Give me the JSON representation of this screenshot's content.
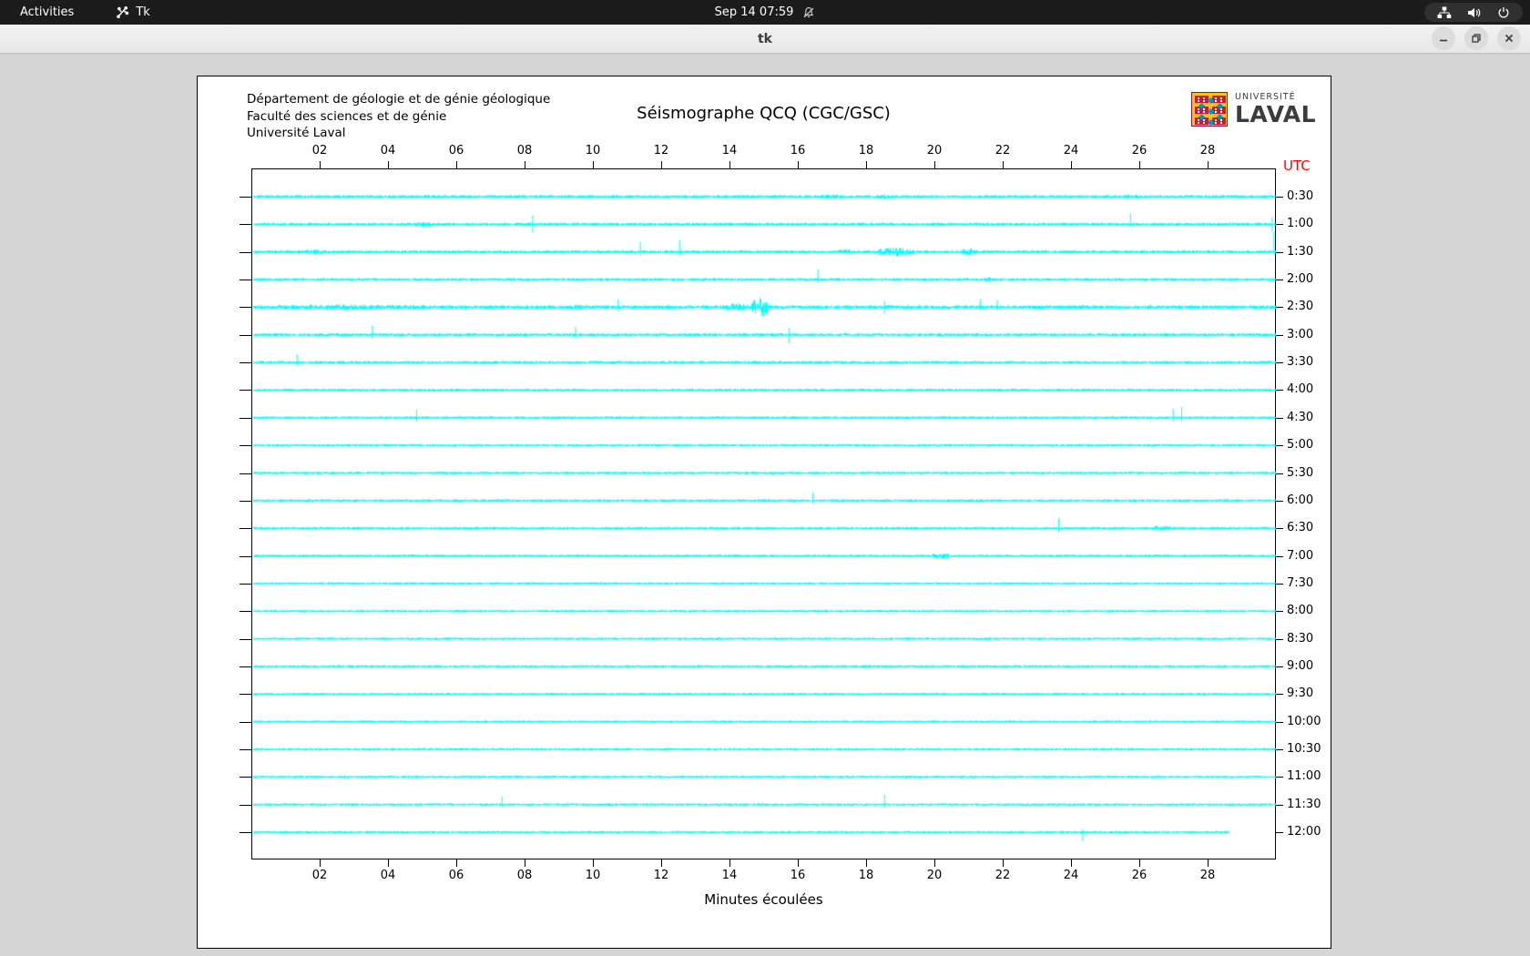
{
  "topbar": {
    "activities_label": "Activities",
    "app_menu_label": "Tk",
    "clock": "Sep 14 07:59"
  },
  "titlebar": {
    "title": "tk"
  },
  "seismograph": {
    "institution_lines": [
      "Département de géologie et de génie géologique",
      "Faculté des sciences et de génie",
      "Université Laval"
    ],
    "title": "Séismographe QCQ (CGC/GSC)",
    "logo": {
      "top": "UNIVERSITÉ",
      "bottom": "LAVAL"
    },
    "utc_label": "UTC",
    "utc_color": "#ff0000",
    "xlabel": "Minutes écoulées",
    "trace_color": "#00ffff"
  },
  "chart_data": {
    "type": "line",
    "title": "Séismographe QCQ (CGC/GSC)",
    "xlabel": "Minutes écoulées",
    "right_axis_label": "UTC",
    "x_range_minutes": [
      0,
      30
    ],
    "x_tick_labels": [
      "02",
      "04",
      "06",
      "08",
      "10",
      "12",
      "14",
      "16",
      "18",
      "20",
      "22",
      "24",
      "26",
      "28"
    ],
    "rows": [
      {
        "utc": "0:30",
        "noise_amp": 1.4,
        "end_minute": 30,
        "bursts": [
          [
            16.6,
            17.3,
            2.6
          ],
          [
            18.2,
            18.9,
            2.3
          ],
          [
            25.4,
            26.1,
            2.3
          ]
        ],
        "spikes": []
      },
      {
        "utc": "1:00",
        "noise_amp": 1.4,
        "end_minute": 30,
        "bursts": [
          [
            4.7,
            5.3,
            3.0
          ]
        ],
        "spikes": [
          [
            8.2,
            10,
            9
          ],
          [
            25.7,
            12,
            3
          ],
          [
            29.85,
            8,
            8
          ]
        ]
      },
      {
        "utc": "1:30",
        "noise_amp": 1.5,
        "end_minute": 30,
        "bursts": [
          [
            1.4,
            2.2,
            2.6
          ],
          [
            17.1,
            17.6,
            3.0
          ],
          [
            18.3,
            19.4,
            4.5
          ],
          [
            20.7,
            21.2,
            3.5
          ]
        ],
        "spikes": [
          [
            11.35,
            11,
            4
          ],
          [
            12.5,
            13,
            4
          ],
          [
            29.9,
            22,
            3
          ]
        ]
      },
      {
        "utc": "2:00",
        "noise_amp": 1.3,
        "end_minute": 30,
        "bursts": [
          [
            21.4,
            21.8,
            2.2
          ]
        ],
        "spikes": [
          [
            16.55,
            11,
            3
          ]
        ]
      },
      {
        "utc": "2:30",
        "noise_amp": 1.8,
        "end_minute": 30,
        "bursts": [
          [
            0.2,
            5.5,
            2.8
          ],
          [
            9.2,
            9.7,
            3.0
          ],
          [
            13.8,
            14.5,
            4.0
          ],
          [
            14.6,
            15.15,
            10.0
          ],
          [
            23.9,
            24.4,
            2.6
          ]
        ],
        "spikes": [
          [
            10.7,
            9,
            4
          ],
          [
            18.5,
            7,
            7
          ],
          [
            21.3,
            9,
            3
          ],
          [
            21.8,
            8,
            3
          ]
        ]
      },
      {
        "utc": "3:00",
        "noise_amp": 1.4,
        "end_minute": 30,
        "bursts": [],
        "spikes": [
          [
            3.5,
            10,
            4
          ],
          [
            9.45,
            9,
            4
          ],
          [
            15.7,
            8,
            9
          ]
        ]
      },
      {
        "utc": "3:30",
        "noise_amp": 1.3,
        "end_minute": 30,
        "bursts": [],
        "spikes": [
          [
            1.3,
            9,
            4
          ]
        ]
      },
      {
        "utc": "4:00",
        "noise_amp": 1.2,
        "end_minute": 30,
        "bursts": [],
        "spikes": []
      },
      {
        "utc": "4:30",
        "noise_amp": 1.2,
        "end_minute": 30,
        "bursts": [],
        "spikes": [
          [
            4.8,
            9,
            4
          ],
          [
            26.95,
            10,
            4
          ],
          [
            27.2,
            12,
            4
          ]
        ]
      },
      {
        "utc": "5:00",
        "noise_amp": 1.1,
        "end_minute": 30,
        "bursts": [],
        "spikes": []
      },
      {
        "utc": "5:30",
        "noise_amp": 1.1,
        "end_minute": 30,
        "bursts": [],
        "spikes": []
      },
      {
        "utc": "6:00",
        "noise_amp": 1.1,
        "end_minute": 30,
        "bursts": [],
        "spikes": [
          [
            16.4,
            9,
            3
          ]
        ]
      },
      {
        "utc": "6:30",
        "noise_amp": 1.1,
        "end_minute": 30,
        "bursts": [
          [
            26.3,
            26.9,
            3.0
          ]
        ],
        "spikes": [
          [
            23.6,
            11,
            4
          ]
        ]
      },
      {
        "utc": "7:00",
        "noise_amp": 1.1,
        "end_minute": 30,
        "bursts": [
          [
            19.9,
            20.4,
            3.2
          ]
        ],
        "spikes": []
      },
      {
        "utc": "7:30",
        "noise_amp": 1.0,
        "end_minute": 30,
        "bursts": [],
        "spikes": []
      },
      {
        "utc": "8:00",
        "noise_amp": 1.0,
        "end_minute": 30,
        "bursts": [],
        "spikes": []
      },
      {
        "utc": "8:30",
        "noise_amp": 1.0,
        "end_minute": 30,
        "bursts": [],
        "spikes": []
      },
      {
        "utc": "9:00",
        "noise_amp": 1.0,
        "end_minute": 30,
        "bursts": [],
        "spikes": []
      },
      {
        "utc": "9:30",
        "noise_amp": 1.0,
        "end_minute": 30,
        "bursts": [],
        "spikes": []
      },
      {
        "utc": "10:00",
        "noise_amp": 1.0,
        "end_minute": 30,
        "bursts": [],
        "spikes": []
      },
      {
        "utc": "10:30",
        "noise_amp": 1.0,
        "end_minute": 30,
        "bursts": [],
        "spikes": []
      },
      {
        "utc": "11:00",
        "noise_amp": 1.0,
        "end_minute": 30,
        "bursts": [],
        "spikes": []
      },
      {
        "utc": "11:30",
        "noise_amp": 1.0,
        "end_minute": 30,
        "bursts": [],
        "spikes": [
          [
            7.3,
            9,
            3
          ],
          [
            18.5,
            11,
            4
          ]
        ]
      },
      {
        "utc": "12:00",
        "noise_amp": 1.0,
        "end_minute": 28.6,
        "bursts": [],
        "spikes": [
          [
            24.3,
            3,
            9
          ]
        ]
      }
    ]
  }
}
